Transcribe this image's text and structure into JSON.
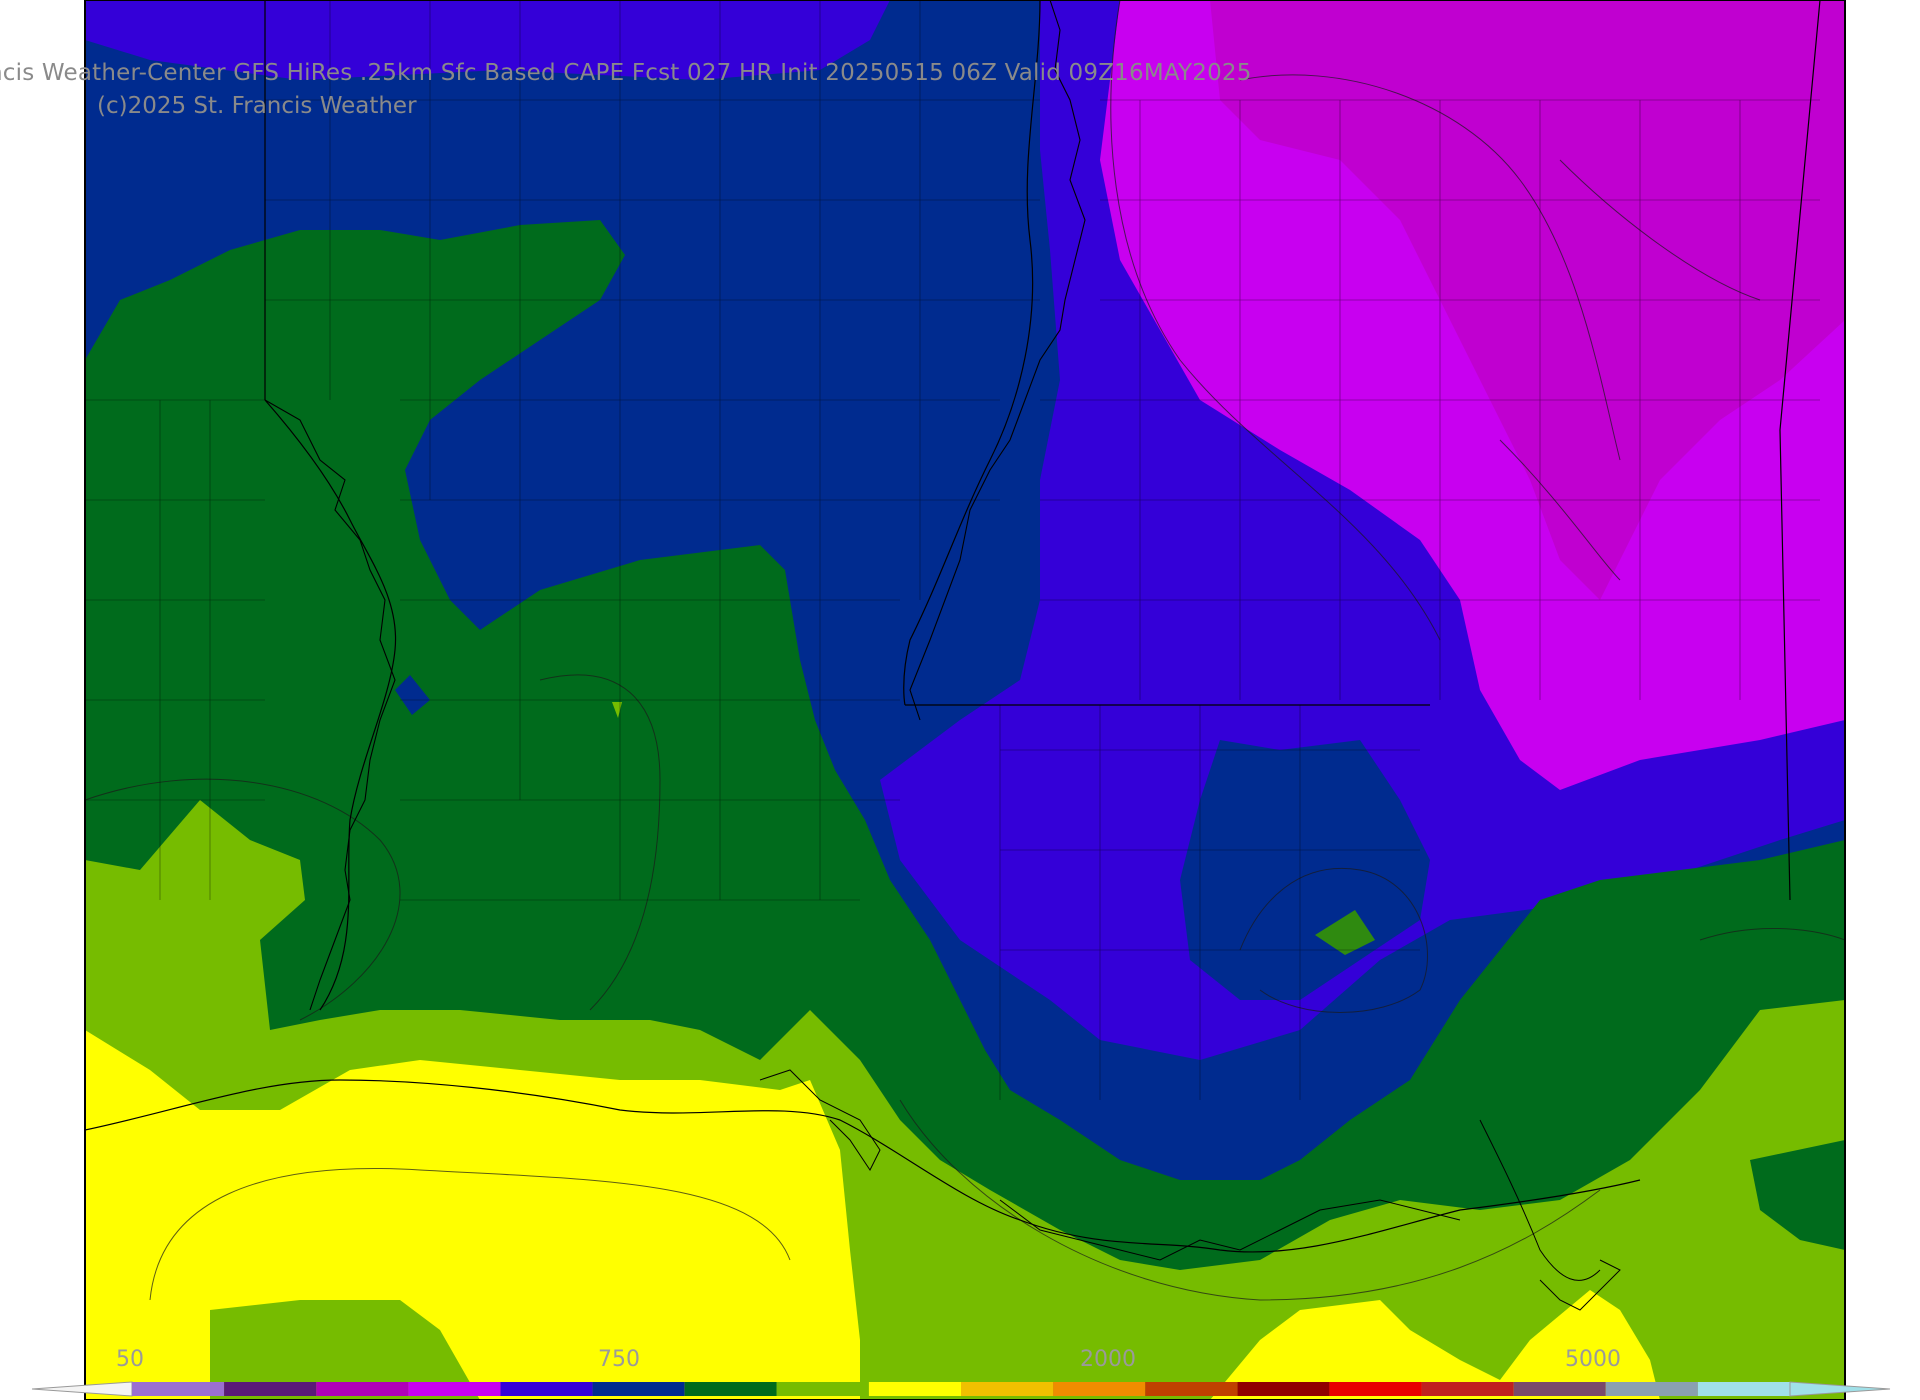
{
  "header": {
    "title": "ncis Weather-Center GFS HiRes .25km Sfc Based CAPE  Fcst 027 HR Init 20250515 06Z  Valid 09Z16MAY2025",
    "copyright": "(c)2025 St. Francis Weather"
  },
  "colorbar": {
    "tick_labels": [
      "50",
      "750",
      "2000",
      "5000"
    ],
    "bins": [
      {
        "color": "#9b6fd0"
      },
      {
        "color": "#5a1a78"
      },
      {
        "color": "#b000b8"
      },
      {
        "color": "#c800f0"
      },
      {
        "color": "#3400d8"
      },
      {
        "color": "#002b8f"
      },
      {
        "color": "#006b1c"
      },
      {
        "color": "#76bc00"
      },
      {
        "color": "#ffff00"
      },
      {
        "color": "#f0c000"
      },
      {
        "color": "#f08c00"
      },
      {
        "color": "#c04000"
      },
      {
        "color": "#900000"
      },
      {
        "color": "#e80000"
      },
      {
        "color": "#c02020"
      },
      {
        "color": "#7a4a6a"
      },
      {
        "color": "#8aa0b0"
      },
      {
        "color": "#a0e0e8"
      }
    ]
  },
  "map": {
    "field": "Sfc Based CAPE",
    "colors": {
      "yellow": "#ffff00",
      "light_green": "#76bc00",
      "dark_green": "#006b1c",
      "navy": "#002b8f",
      "blue_violet": "#3400d8",
      "violet": "#c800f0",
      "magenta": "#c000d0"
    }
  }
}
